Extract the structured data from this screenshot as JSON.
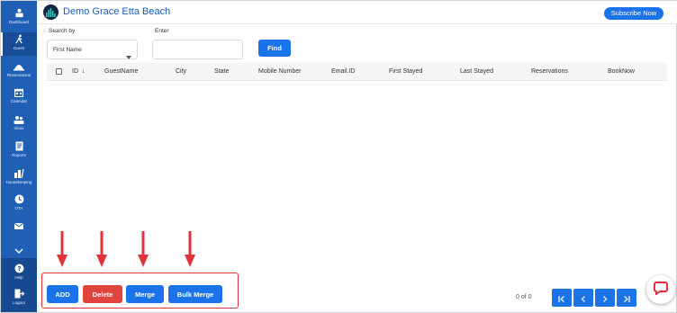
{
  "sidebar": {
    "items": [
      {
        "label": "Dashboard",
        "icon": "dashboard-icon"
      },
      {
        "label": "Guest",
        "icon": "guest-icon",
        "active": true
      },
      {
        "label": "Reservations",
        "icon": "reservations-icon"
      },
      {
        "label": "Calendar",
        "icon": "calendar-icon"
      },
      {
        "label": "Inbox",
        "icon": "inbox-icon"
      },
      {
        "label": "Reports",
        "icon": "reports-icon"
      },
      {
        "label": "Housekeeping",
        "icon": "housekeeping-icon"
      },
      {
        "label": "OTA",
        "icon": "ota-icon"
      },
      {
        "label": "",
        "icon": "email-icon"
      }
    ],
    "bottom": [
      {
        "label": "Help",
        "icon": "help-icon"
      },
      {
        "label": "Logout",
        "icon": "logout-icon"
      }
    ]
  },
  "header": {
    "title": "Demo Grace Etta Beach",
    "subscribe_label": "Subscribe Now"
  },
  "search": {
    "search_by_label": "Search by",
    "search_by_value": "First Name",
    "enter_label": "Enter",
    "enter_value": "",
    "find_label": "Find"
  },
  "table": {
    "columns": [
      "ID",
      "GuestName",
      "City",
      "State",
      "Mobile Number",
      "Email.ID",
      "First Stayed",
      "Last Stayed",
      "Reservations",
      "BookNow"
    ],
    "rows": []
  },
  "actions": {
    "add_label": "ADD",
    "delete_label": "Delete",
    "merge_label": "Merge",
    "bulk_merge_label": "Bulk Merge"
  },
  "pager": {
    "status": "0 of 0"
  },
  "colors": {
    "sidebar": "#1f5fb5",
    "primary": "#1a73e8",
    "danger": "#e0443e",
    "annotation": "#e0333b"
  }
}
